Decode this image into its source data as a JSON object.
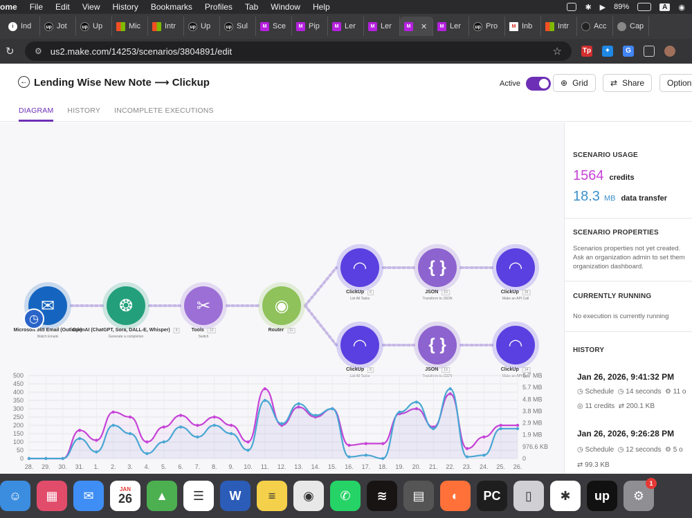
{
  "menubar": {
    "app": "ome",
    "items": [
      "File",
      "Edit",
      "View",
      "History",
      "Bookmarks",
      "Profiles",
      "Tab",
      "Window",
      "Help"
    ],
    "battery": "89%"
  },
  "tabs": [
    {
      "label": "Ind",
      "icon": "info"
    },
    {
      "label": "Jot",
      "icon": "up"
    },
    {
      "label": "Up",
      "icon": "up"
    },
    {
      "label": "Mic",
      "icon": "ms"
    },
    {
      "label": "Intr",
      "icon": "ms"
    },
    {
      "label": "Up",
      "icon": "up"
    },
    {
      "label": "Sul",
      "icon": "up"
    },
    {
      "label": "Sce",
      "icon": "mk"
    },
    {
      "label": "Pip",
      "icon": "mk"
    },
    {
      "label": "Ler",
      "icon": "mk"
    },
    {
      "label": "Ler",
      "icon": "mk"
    },
    {
      "label": "",
      "icon": "mk",
      "active": true
    },
    {
      "label": "Ler",
      "icon": "mk"
    },
    {
      "label": "Pro",
      "icon": "up"
    },
    {
      "label": "Inb",
      "icon": "gm"
    },
    {
      "label": "Intr",
      "icon": "ms"
    },
    {
      "label": "Acc",
      "icon": "blk"
    },
    {
      "label": "Cap",
      "icon": "gl"
    }
  ],
  "address": {
    "url": "us2.make.com/14253/scenarios/3804891/edit"
  },
  "header": {
    "title": "Lending Wise New Note ⟶ Clickup",
    "active_label": "Active",
    "grid_label": "Grid",
    "share_label": "Share",
    "options_label": "Option",
    "tabs": [
      "DIAGRAM",
      "HISTORY",
      "INCOMPLETE EXECUTIONS"
    ]
  },
  "modules": [
    {
      "name": "Microsoft 365 Email (Outlook)",
      "sub": "Watch Emails",
      "color": "#1565c0"
    },
    {
      "name": "OpenAI (ChatGPT, Sora, DALL-E, Whisper)",
      "sub": "Generate a completion",
      "num": "4",
      "color": "#23a07b"
    },
    {
      "name": "Tools",
      "sub": "Switch",
      "num": "12",
      "color": "#9c6fd6"
    },
    {
      "name": "Router",
      "num": "11",
      "color": "#8fc25a"
    },
    {
      "name": "ClickUp",
      "sub": "List All Tasks",
      "num": "6",
      "color": "#5a40e0"
    },
    {
      "name": "JSON",
      "sub": "Transform to JSON",
      "num": "10",
      "color": "#8d63cf"
    },
    {
      "name": "ClickUp",
      "sub": "Make an API Call",
      "num": "16",
      "color": "#5a40e0"
    },
    {
      "name": "ClickUp",
      "sub": "List All Tasks",
      "num": "8",
      "color": "#5a40e0"
    },
    {
      "name": "JSON",
      "sub": "Transform to JSON",
      "num": "13",
      "color": "#8d63cf"
    },
    {
      "name": "ClickUp",
      "sub": "Make an API Call",
      "num": "14",
      "color": "#5a40e0"
    }
  ],
  "sidebar": {
    "usage_title": "SCENARIO USAGE",
    "credits_value": "1564",
    "credits_label": "credits",
    "transfer_value": "18.3",
    "transfer_unit": "MB",
    "transfer_label": "data transfer",
    "properties_title": "SCENARIO PROPERTIES",
    "properties_text": [
      "Scenarios properties not yet created.",
      "Ask an organization admin to set them",
      "organization dashboard."
    ],
    "running_title": "CURRENTLY RUNNING",
    "running_text": "No execution is currently running",
    "history_title": "HISTORY",
    "history": [
      {
        "date": "Jan 26, 2026, 9:41:32 PM",
        "trigger": "Schedule",
        "duration": "14 seconds",
        "ops": "11 o",
        "credits": "11 credits",
        "transfer": "200.1 KB"
      },
      {
        "date": "Jan 26, 2026, 9:26:28 PM",
        "trigger": "Schedule",
        "duration": "12 seconds",
        "ops": "5 o",
        "transfer": "99.3 KB"
      }
    ]
  },
  "chart_data": {
    "type": "line",
    "categories": [
      "28.",
      "29.",
      "30.",
      "31.",
      "1.",
      "2.",
      "3.",
      "4.",
      "5.",
      "6.",
      "7.",
      "8.",
      "9.",
      "10.",
      "11.",
      "12.",
      "13.",
      "14.",
      "15.",
      "16.",
      "17.",
      "18.",
      "19.",
      "20.",
      "21.",
      "22.",
      "23.",
      "24.",
      "25.",
      "26."
    ],
    "y_left_ticks": [
      "500",
      "450",
      "400",
      "350",
      "300",
      "250",
      "200",
      "150",
      "100",
      "50",
      "0"
    ],
    "y_right_ticks": [
      "6.7 MB",
      "5.7 MB",
      "4.8 MB",
      "3.8 MB",
      "2.9 MB",
      "1.9 MB",
      "976.6 KB",
      "0"
    ],
    "ylim": [
      0,
      500
    ],
    "series": [
      {
        "color": "#c643d6",
        "values": [
          0,
          0,
          0,
          170,
          110,
          280,
          250,
          100,
          190,
          260,
          200,
          250,
          200,
          100,
          420,
          200,
          310,
          250,
          300,
          80,
          90,
          90,
          270,
          300,
          190,
          390,
          60,
          130,
          200,
          200
        ]
      },
      {
        "color": "#48a6d3",
        "values": [
          0,
          0,
          0,
          120,
          40,
          200,
          150,
          30,
          100,
          190,
          130,
          200,
          150,
          50,
          350,
          210,
          330,
          260,
          300,
          10,
          20,
          0,
          280,
          340,
          180,
          420,
          10,
          20,
          180,
          180
        ]
      }
    ]
  },
  "dock": [
    {
      "name": "finder",
      "label": "☺",
      "color": "#3b8de0"
    },
    {
      "name": "launchpad",
      "label": "▦",
      "color": "#e24c6b"
    },
    {
      "name": "mail",
      "label": "✉",
      "color": "#3f8ef5"
    },
    {
      "name": "calendar",
      "label": "26",
      "month": "JAN",
      "color": "#ffffff"
    },
    {
      "name": "maps",
      "label": "▲",
      "color": "#4caf50"
    },
    {
      "name": "reminders",
      "label": "☰",
      "color": "#ffffff"
    },
    {
      "name": "word",
      "label": "W",
      "color": "#2b5cb8"
    },
    {
      "name": "notes",
      "label": "≡",
      "color": "#f5d04a"
    },
    {
      "name": "chrome",
      "label": "◉",
      "color": "#e8e8e8"
    },
    {
      "name": "whatsapp",
      "label": "✆",
      "color": "#25d366"
    },
    {
      "name": "spotify",
      "label": "≋",
      "color": "#191414"
    },
    {
      "name": "calculator",
      "label": "▤",
      "color": "#555555"
    },
    {
      "name": "firefox",
      "label": "◐",
      "color": "#ff7139"
    },
    {
      "name": "pycharm",
      "label": "PC",
      "color": "#1e1e1e"
    },
    {
      "name": "iphone-mirroring",
      "label": "▯",
      "color": "#cfcfd4"
    },
    {
      "name": "slack",
      "label": "✱",
      "color": "#ffffff"
    },
    {
      "name": "upwork",
      "label": "up",
      "color": "#111111"
    },
    {
      "name": "system-settings",
      "label": "⚙",
      "color": "#8e8e93",
      "badge": "1"
    }
  ]
}
